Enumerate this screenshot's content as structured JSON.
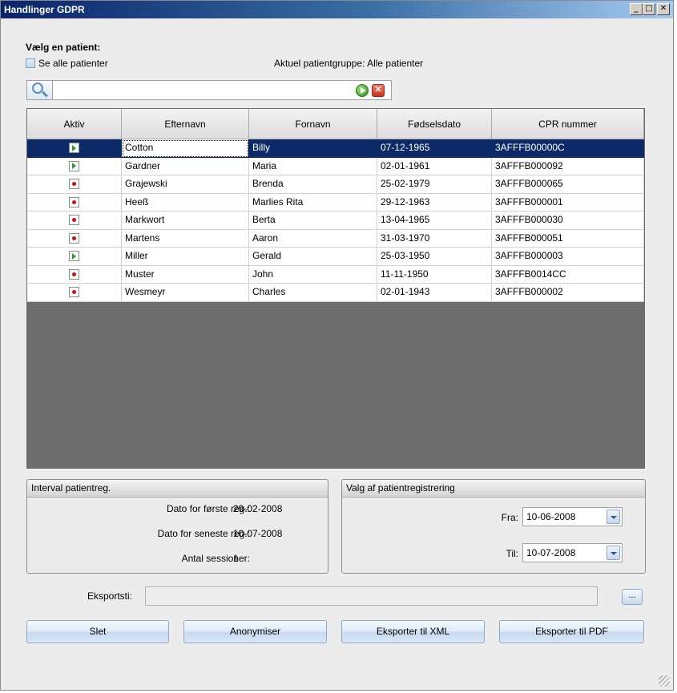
{
  "window": {
    "title": "Handlinger GDPR",
    "controls": {
      "minimize": "_",
      "maximize": "□",
      "close": "✕"
    }
  },
  "select_patient": {
    "heading": "Vælg en patient:",
    "show_all_label": "Se alle patienter",
    "current_group": "Aktuel patientgruppe: Alle patienter"
  },
  "search": {
    "value": "",
    "placeholder": ""
  },
  "table": {
    "columns": [
      "Aktiv",
      "Efternavn",
      "Fornavn",
      "Fødselsdato",
      "CPR nummer"
    ],
    "rows": [
      {
        "active": true,
        "last": "Cotton",
        "first": "Billy",
        "dob": "07-12-1965",
        "cpr": "3AFFFB00000C"
      },
      {
        "active": true,
        "last": "Gardner",
        "first": "Maria",
        "dob": "02-01-1961",
        "cpr": "3AFFFB000092"
      },
      {
        "active": false,
        "last": "Grajewski",
        "first": "Brenda",
        "dob": "25-02-1979",
        "cpr": "3AFFFB000065"
      },
      {
        "active": false,
        "last": "Heeß",
        "first": "Marlies Rita",
        "dob": "29-12-1963",
        "cpr": "3AFFFB000001"
      },
      {
        "active": false,
        "last": "Markwort",
        "first": "Berta",
        "dob": "13-04-1965",
        "cpr": "3AFFFB000030"
      },
      {
        "active": false,
        "last": "Martens",
        "first": "Aaron",
        "dob": "31-03-1970",
        "cpr": "3AFFFB000051"
      },
      {
        "active": true,
        "last": "Miller",
        "first": "Gerald",
        "dob": "25-03-1950",
        "cpr": "3AFFFB000003"
      },
      {
        "active": false,
        "last": "Muster",
        "first": "John",
        "dob": "11-11-1950",
        "cpr": "3AFFFB0014CC"
      },
      {
        "active": false,
        "last": "Wesmeyr",
        "first": "Charles",
        "dob": "02-01-1943",
        "cpr": "3AFFFB000002"
      }
    ],
    "selected_row": 0
  },
  "interval": {
    "title": "Interval patientreg.",
    "first_label": "Dato for første reg.:",
    "first_value": "29-02-2008",
    "last_label": "Dato for seneste reg.:",
    "last_value": "10-07-2008",
    "sessions_label": "Antal sessioner:",
    "sessions_value": "1"
  },
  "selection": {
    "title": "Valg af patientregistrering",
    "from_label": "Fra:",
    "from_value": "10-06-2008",
    "to_label": "Til:",
    "to_value": "10-07-2008"
  },
  "export": {
    "label": "Eksportsti:",
    "value": "",
    "browse_label": "..."
  },
  "buttons": {
    "delete": "Slet",
    "anonymize": "Anonymiser",
    "export_xml": "Eksporter til XML",
    "export_pdf": "Eksporter til PDF"
  },
  "colors": {
    "title_bar": "#0a246a",
    "selection": "#0d2a68",
    "grid_empty": "#6d6d6d",
    "active_icon": "#2a9a2a",
    "inactive_icon": "#d01010"
  }
}
